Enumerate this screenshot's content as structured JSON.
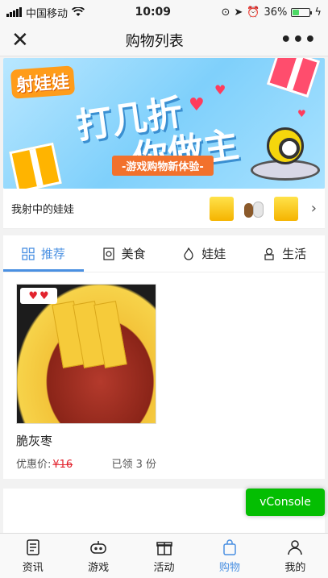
{
  "status_bar": {
    "carrier": "中国移动",
    "time": "10:09",
    "battery": "36%",
    "battery_level": 0.36
  },
  "nav": {
    "title": "购物列表",
    "close_icon": "close-icon",
    "more_icon": "more-icon"
  },
  "banner": {
    "logo": "射娃娃",
    "headline_1": "打几折",
    "headline_2": "你做主",
    "tagline": "-游戏购物新体验-"
  },
  "my_catches": {
    "label": "我射中的娃娃"
  },
  "tabs": [
    {
      "label": "推荐",
      "icon": "grid-icon",
      "active": true
    },
    {
      "label": "美食",
      "icon": "food-icon",
      "active": false
    },
    {
      "label": "娃娃",
      "icon": "flame-icon",
      "active": false
    },
    {
      "label": "生活",
      "icon": "life-icon",
      "active": false
    }
  ],
  "product": {
    "name": "脆灰枣",
    "price_label": "优惠价:",
    "price": "¥16",
    "claimed": "已领 3 份"
  },
  "vconsole": "vConsole",
  "bottom_tabs": [
    {
      "label": "资讯",
      "icon": "news-icon",
      "active": false
    },
    {
      "label": "游戏",
      "icon": "game-icon",
      "active": false
    },
    {
      "label": "活动",
      "icon": "gift-icon",
      "active": false
    },
    {
      "label": "购物",
      "icon": "shopping-bag-icon",
      "active": true
    },
    {
      "label": "我的",
      "icon": "user-icon",
      "active": false
    }
  ],
  "colors": {
    "accent": "#4a90e2",
    "price": "#e2242e",
    "vconsole": "#04be02"
  }
}
